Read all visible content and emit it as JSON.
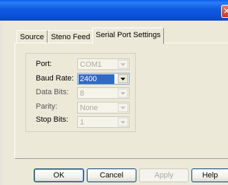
{
  "window": {
    "close_glyph": "✕"
  },
  "tabs": [
    {
      "label": "Source",
      "active": false
    },
    {
      "label": "Steno Feed",
      "active": false
    },
    {
      "label": "Serial Port Settings",
      "active": true
    }
  ],
  "settings": {
    "port": {
      "label": "Port:",
      "value": "COM1",
      "enabled": false
    },
    "baud_rate": {
      "label": "Baud Rate:",
      "value": "2400",
      "enabled": true
    },
    "data_bits": {
      "label": "Data Bits:",
      "value": "8",
      "enabled": false
    },
    "parity": {
      "label": "Parity:",
      "value": "None",
      "enabled": false
    },
    "stop_bits": {
      "label": "Stop Bits:",
      "value": "1",
      "enabled": false
    }
  },
  "buttons": {
    "ok": "OK",
    "cancel": "Cancel",
    "apply": "Apply",
    "help": "Help"
  },
  "icons": {
    "dropdown": "chevron-down-icon",
    "close": "close-icon"
  },
  "colors": {
    "titlebar": "#0a5ee8",
    "selection": "#316ac5",
    "face": "#ece9d8"
  }
}
